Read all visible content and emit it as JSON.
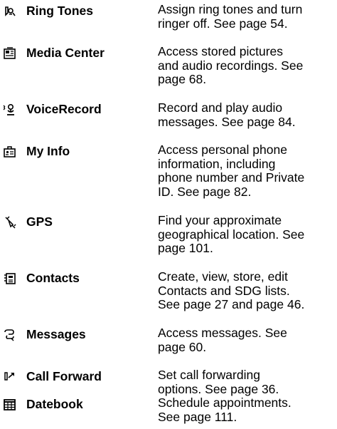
{
  "items": [
    {
      "icon": "ring-tones-icon",
      "name": "Ring Tones",
      "lines": [
        "Assign ring tones and turn",
        "ringer off. See page 54."
      ]
    },
    {
      "icon": "media-center-icon",
      "name": "Media Center",
      "lines": [
        "Access stored pictures",
        "and audio recordings. See",
        "page 68."
      ]
    },
    {
      "icon": "voice-record-icon",
      "name": "VoiceRecord",
      "lines": [
        "Record and play audio",
        "messages. See page 84."
      ]
    },
    {
      "icon": "my-info-icon",
      "name": "My Info",
      "lines": [
        "Access personal phone",
        "information, including",
        "phone number and Private",
        "ID. See page 82."
      ]
    },
    {
      "icon": "gps-satellite-icon",
      "name": "GPS",
      "lines": [
        "Find your approximate",
        "geographical location. See",
        "page 101."
      ]
    },
    {
      "icon": "contacts-icon",
      "name": "Contacts",
      "lines": [
        "Create, view, store, edit",
        "Contacts and SDG lists.",
        "See page 27 and page 46."
      ]
    },
    {
      "icon": "messages-icon",
      "name": "Messages",
      "lines": [
        "Access messages. See",
        "page 60."
      ]
    },
    {
      "icon": "call-forward-icon",
      "name": "Call Forward",
      "lines": [
        "Set call forwarding",
        "options. See page 36."
      ]
    },
    {
      "icon": "datebook-icon",
      "name": "Datebook",
      "lines": [
        "Schedule appointments.",
        "See page 111."
      ]
    }
  ]
}
